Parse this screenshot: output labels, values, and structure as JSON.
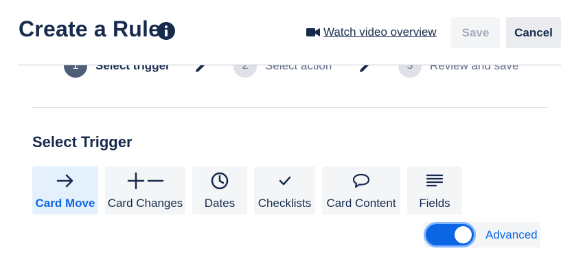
{
  "header": {
    "title": "Create a Rule",
    "video_link": "Watch video overview",
    "save_label": "Save",
    "cancel_label": "Cancel"
  },
  "steps": [
    {
      "number": "1",
      "label": "Select trigger",
      "state": "active"
    },
    {
      "number": "2",
      "label": "Select action",
      "state": "inactive"
    },
    {
      "number": "3",
      "label": "Review and save",
      "state": "inactive"
    }
  ],
  "trigger": {
    "section_title": "Select Trigger",
    "tiles": [
      {
        "label": "Card Move",
        "icon": "arrow-right-icon",
        "selected": true
      },
      {
        "label": "Card Changes",
        "icon": "plus-minus-icon",
        "selected": false
      },
      {
        "label": "Dates",
        "icon": "clock-icon",
        "selected": false
      },
      {
        "label": "Checklists",
        "icon": "checkmark-icon",
        "selected": false
      },
      {
        "label": "Card Content",
        "icon": "speech-bubble-icon",
        "selected": false
      },
      {
        "label": "Fields",
        "icon": "lines-icon",
        "selected": false
      }
    ]
  },
  "advanced": {
    "label": "Advanced",
    "enabled": true
  },
  "colors": {
    "text": "#172b4d",
    "accent": "#0c66e4",
    "selected_tile": "#e4f0fb",
    "tile": "#f4f5f7"
  }
}
